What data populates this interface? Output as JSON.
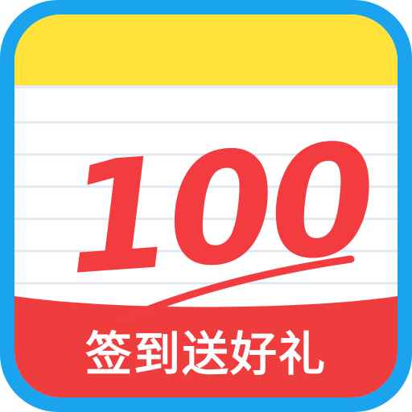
{
  "app_icon": {
    "score_text": "100",
    "banner_label": "签到送好礼",
    "colors": {
      "frame_blue": "#1aa3ef",
      "top_yellow": "#ffe23a",
      "paper_white": "#ffffff",
      "rule_lines": "#dfe8f2",
      "score_red": "#f23c3f",
      "banner_red": "#ef3d3d",
      "banner_text": "#ffffff"
    },
    "icons": [
      "notebook-icon",
      "score-underline-icon"
    ]
  }
}
